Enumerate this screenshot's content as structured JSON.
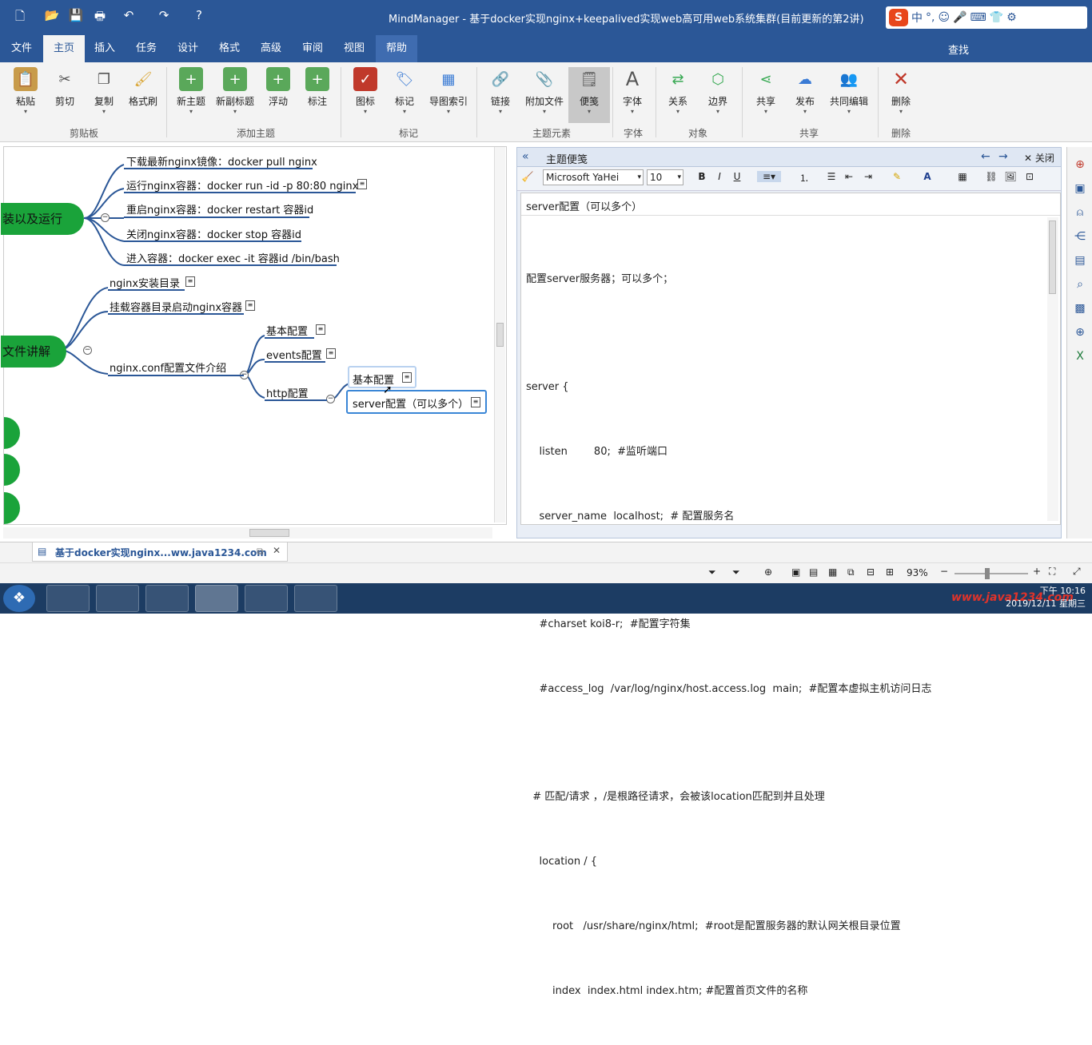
{
  "window": {
    "title": "MindManager - 基于docker实现nginx+keepalived实现web高可用web系统集群(目前更新的第2讲)"
  },
  "ime": {
    "label": "中",
    "punct": "°,"
  },
  "menu": {
    "items": [
      "文件",
      "主页",
      "插入",
      "任务",
      "设计",
      "格式",
      "高级",
      "审阅",
      "视图",
      "帮助"
    ],
    "search": "查找"
  },
  "ribbon": {
    "buttons": [
      "粘贴",
      "剪切",
      "复制",
      "格式刷",
      "新主题",
      "新副标题",
      "浮动",
      "标注",
      "图标",
      "标记",
      "导图索引",
      "链接",
      "附加文件",
      "便笺",
      "字体",
      "关系",
      "边界",
      "共享",
      "发布",
      "共同编辑",
      "删除"
    ],
    "groups": [
      "剪贴板",
      "添加主题",
      "标记",
      "主题元素",
      "字体",
      "对象",
      "共享",
      "删除"
    ]
  },
  "mindmap": {
    "main_topics": [
      "装以及运行",
      "文件讲解"
    ],
    "subtopics": [
      "下载最新nginx镜像：docker pull nginx",
      "运行nginx容器：docker run -id -p 80:80  nginx",
      "重启nginx容器：docker restart 容器id",
      "关闭nginx容器：docker stop 容器id",
      "进入容器：docker exec -it 容器id /bin/bash",
      "nginx安装目录",
      "挂载容器目录启动nginx容器",
      "基本配置",
      "events配置",
      "nginx.conf配置文件介绍",
      "http配置",
      "基本配置",
      "server配置（可以多个）"
    ]
  },
  "note_panel": {
    "title": "主题便笺",
    "close": "关闭",
    "font": "Microsoft YaHei",
    "size": "10",
    "topic_title": "server配置（可以多个）",
    "lines": [
      "配置server服务器；可以多个；",
      "",
      "server {",
      "    listen        80;  #监听端口",
      "    server_name  localhost;  # 配置服务名",
      "",
      "    #charset koi8-r;  #配置字符集",
      "    #access_log  /var/log/nginx/host.access.log  main;  #配置本虚拟主机访问日志",
      "",
      "  # 匹配/请求 ，/是根路径请求，会被该location匹配到并且处理",
      "    location / {",
      "        root   /usr/share/nginx/html;  #root是配置服务器的默认网关根目录位置",
      "        index  index.html index.htm; #配置首页文件的名称"
    ]
  },
  "doc_tab": {
    "label": "基于docker实现nginx...ww.java1234.com"
  },
  "status": {
    "zoom": "93%"
  },
  "taskbar": {
    "time": "下午 10:16",
    "date": "2019/12/11 星期三",
    "watermark": "www.java1234.com"
  },
  "colors": {
    "accent": "#2b5797",
    "topic_green": "#1aa33a"
  }
}
